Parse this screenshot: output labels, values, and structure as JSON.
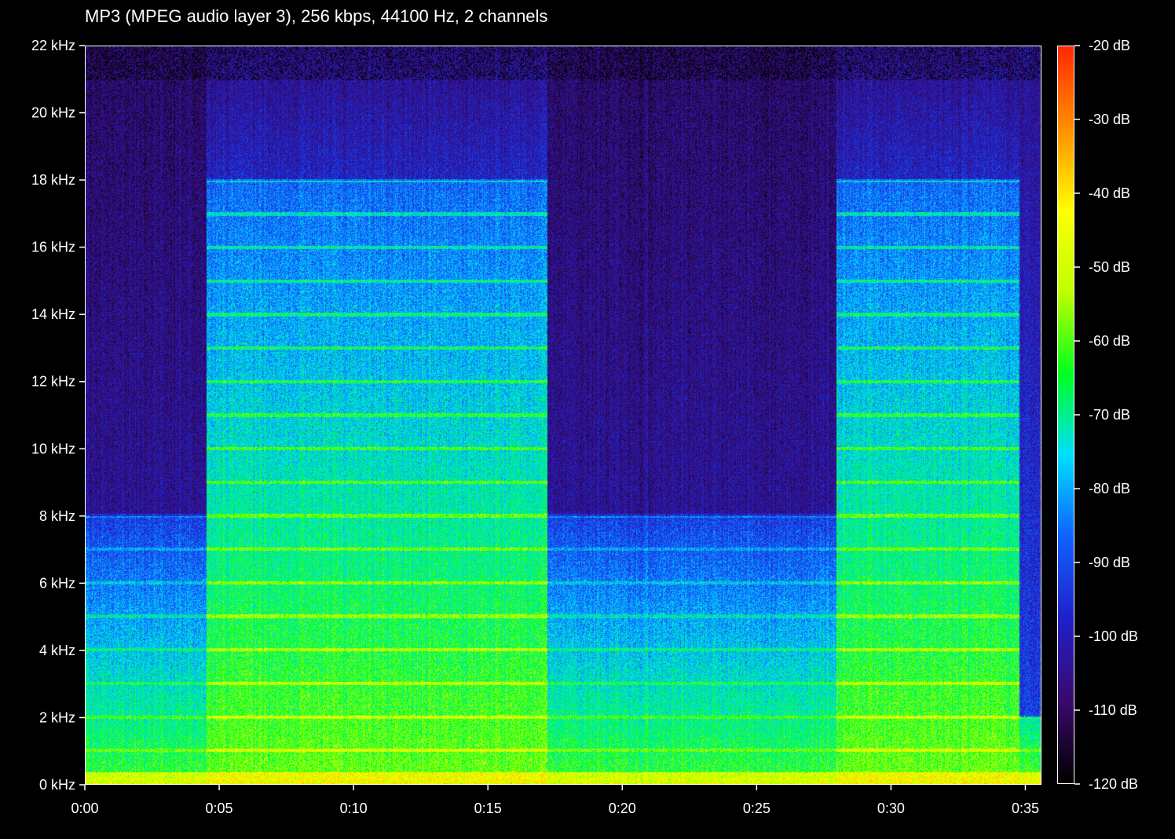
{
  "chart_data": {
    "type": "heatmap",
    "title": "MP3 (MPEG audio layer 3), 256 kbps, 44100 Hz, 2 channels",
    "x": {
      "ticks": [
        0,
        5,
        10,
        15,
        20,
        25,
        30,
        35
      ],
      "tick_labels": [
        "0:00",
        "0:05",
        "0:10",
        "0:15",
        "0:20",
        "0:25",
        "0:30",
        "0:35"
      ],
      "range": [
        0,
        35.6
      ],
      "unit": "seconds"
    },
    "y": {
      "ticks": [
        0,
        2,
        4,
        6,
        8,
        10,
        12,
        14,
        16,
        18,
        20,
        22
      ],
      "tick_labels": [
        "0 kHz",
        "2 kHz",
        "4 kHz",
        "6 kHz",
        "8 kHz",
        "10 kHz",
        "12 kHz",
        "14 kHz",
        "16 kHz",
        "18 kHz",
        "20 kHz",
        "22 kHz"
      ],
      "range": [
        0,
        22
      ],
      "unit": "kHz"
    },
    "colorbar": {
      "ticks": [
        -20,
        -30,
        -40,
        -50,
        -60,
        -70,
        -80,
        -90,
        -100,
        -110,
        -120
      ],
      "tick_labels": [
        "-20 dB",
        "-30 dB",
        "-40 dB",
        "-50 dB",
        "-60 dB",
        "-70 dB",
        "-80 dB",
        "-90 dB",
        "-100 dB",
        "-110 dB",
        "-120 dB"
      ],
      "range": [
        -120,
        -20
      ],
      "colors": [
        "#000000",
        "#3a0a6e",
        "#2020c8",
        "#1060ff",
        "#00e0ff",
        "#00ff20",
        "#c0ff00",
        "#ffff00",
        "#ff9000",
        "#ff2a00"
      ]
    },
    "segments": [
      {
        "start": 0.0,
        "end": 4.5,
        "level": "quiet",
        "cutoff_khz": 8
      },
      {
        "start": 4.5,
        "end": 17.2,
        "level": "loud",
        "cutoff_khz": 18
      },
      {
        "start": 17.2,
        "end": 28.0,
        "level": "quiet",
        "cutoff_khz": 8
      },
      {
        "start": 28.0,
        "end": 34.8,
        "level": "loud",
        "cutoff_khz": 18
      },
      {
        "start": 34.8,
        "end": 35.6,
        "level": "fade",
        "cutoff_khz": 2
      }
    ],
    "harmonic_lines_khz": [
      1,
      2,
      3,
      4,
      5,
      6,
      7,
      8,
      9,
      10,
      11,
      12,
      13,
      14,
      15,
      16,
      17,
      18
    ]
  }
}
